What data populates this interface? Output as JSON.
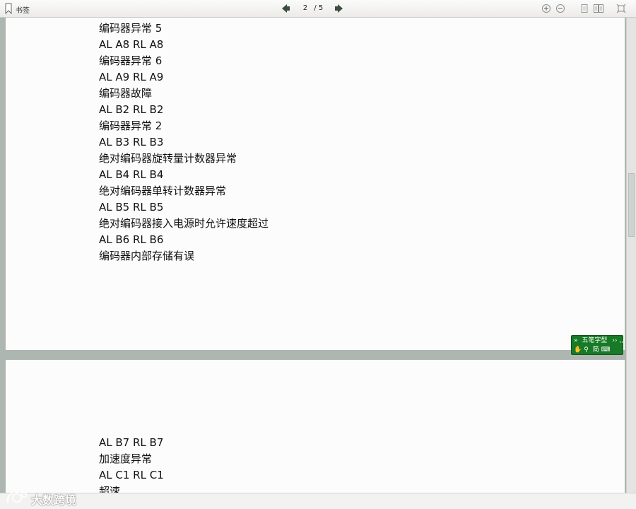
{
  "toolbar": {
    "bookmark_label": "书签",
    "current_page": "2",
    "total_pages": "/ 5",
    "icons": [
      "bookmark-icon",
      "prev-page-icon",
      "next-page-icon",
      "zoom-in-icon",
      "zoom-out-icon",
      "single-page-icon",
      "two-page-icon",
      "fit-window-icon"
    ]
  },
  "page1_lines": [
    "编码器异常 5",
    "AL A8 RL A8",
    "编码器异常 6",
    "AL A9 RL A9",
    "编码器故障",
    "AL B2 RL B2",
    "编码器异常 2",
    "AL B3 RL B3",
    "绝对编码器旋转量计数器异常",
    "AL B4 RL B4",
    "绝对编码器单转计数器异常",
    "AL B5 RL B5",
    "绝对编码器接入电源时允许速度超过",
    "AL B6 RL B6",
    "编码器内部存储有误"
  ],
  "page2_lines": [
    "AL B7 RL B7",
    "加速度异常",
    "AL C1 RL C1",
    "超速"
  ],
  "ime": {
    "name": "五笔字型",
    "mode": "简",
    "extra": "›› ‚‚"
  },
  "watermark": {
    "text": "大数跨境"
  },
  "colors": {
    "ime_green": "#177a26",
    "background": "#aeb6b1",
    "nav_arrow": "#3b4d3f"
  }
}
